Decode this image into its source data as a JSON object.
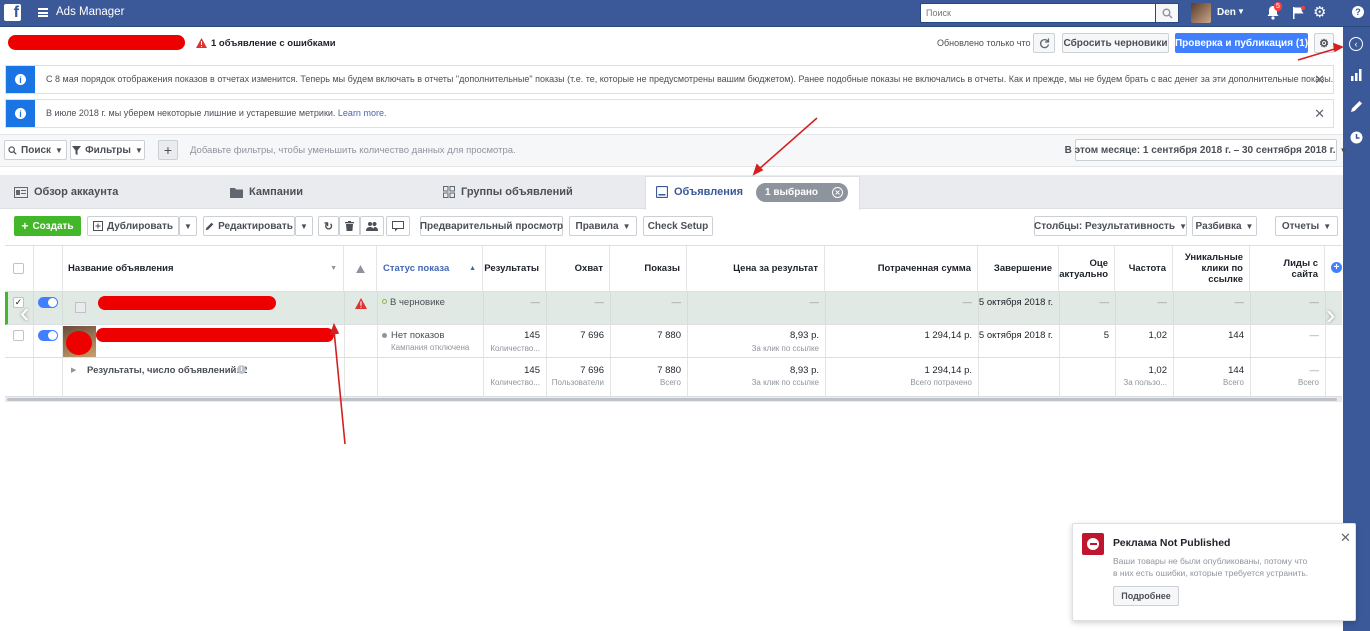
{
  "topbar": {
    "logo": "f",
    "app_title": "Ads Manager",
    "search_placeholder": "Поиск",
    "user_name": "Den",
    "notification_count": "5"
  },
  "subheader": {
    "error_text": "1 объявление с ошибками",
    "updated_text": "Обновлено только что",
    "reset_label": "Сбросить черновики",
    "publish_label": "Проверка и публикация (1)"
  },
  "banners": [
    {
      "text": "С 8 мая порядок отображения показов в отчетах изменится. Теперь мы будем включать в отчеты \"дополнительные\" показы (т.е. те, которые не предусмотрены вашим бюджетом). Ранее подобные показы не включались в отчеты. Как и прежде, мы не будем брать с вас денег за эти дополнительные показы."
    },
    {
      "text": "В июле 2018 г. мы уберем некоторые лишние и устаревшие метрики.",
      "link": "Learn more."
    }
  ],
  "filterbar": {
    "search_label": "Поиск",
    "filters_label": "Фильтры",
    "add_hint": "Добавьте фильтры, чтобы уменьшить количество данных для просмотра.",
    "date_range": "В этом месяце: 1 сентября 2018 г. – 30 сентября 2018 г."
  },
  "tabs": [
    {
      "label": "Обзор аккаунта"
    },
    {
      "label": "Кампании"
    },
    {
      "label": "Группы объявлений"
    },
    {
      "label": "Объявления"
    }
  ],
  "selected_badge": "1 выбрано",
  "toolbar": {
    "create": "Создать",
    "duplicate": "Дублировать",
    "edit": "Редактировать",
    "preview": "Предварительный просмотр",
    "rules": "Правила",
    "check_setup": "Check Setup",
    "columns": "Столбцы: Результативность",
    "breakdown": "Разбивка",
    "reports": "Отчеты"
  },
  "columns": {
    "name": "Название объявления",
    "status": "Статус показа",
    "results": "Результаты",
    "reach": "Охват",
    "impressions": "Показы",
    "cpr": "Цена за результат",
    "spent": "Потраченная сумма",
    "end": "Завершение",
    "relevance": "Оце актуально",
    "frequency": "Частота",
    "unique_clicks": "Уникальные клики по ссылке",
    "leads": "Лиды с сайта"
  },
  "rows": [
    {
      "status": "В черновике",
      "status_color": "#8ab94a",
      "results": "—",
      "reach": "—",
      "impressions": "—",
      "cpr": "—",
      "spent": "—",
      "end": "5 октября 2018 г.",
      "relevance": "—",
      "frequency": "—",
      "unique_clicks": "—",
      "leads": "—"
    },
    {
      "status": "Нет показов",
      "status_sub": "Кампания отключена",
      "status_color": "#90949c",
      "results": "145",
      "results_sub": "Количество...",
      "reach": "7 696",
      "impressions": "7 880",
      "cpr": "8,93 р.",
      "cpr_sub": "За клик по ссылке",
      "spent": "1 294,14 р.",
      "end": "5 октября 2018 г.",
      "relevance": "5",
      "frequency": "1,02",
      "unique_clicks": "144",
      "leads": "—"
    }
  ],
  "totals": {
    "label": "Результаты, число объявлений: 2",
    "results": "145",
    "results_sub": "Количество...",
    "reach": "7 696",
    "reach_sub": "Пользователи",
    "impressions": "7 880",
    "impressions_sub": "Всего",
    "cpr": "8,93 р.",
    "cpr_sub": "За клик по ссылке",
    "spent": "1 294,14 р.",
    "spent_sub": "Всего потрачено",
    "frequency": "1,02",
    "frequency_sub": "За пользо...",
    "unique_clicks": "144",
    "unique_clicks_sub": "Всего",
    "leads": "—",
    "leads_sub": "Всего"
  },
  "toast": {
    "title": "Реклама Not Published",
    "body": "Ваши товары не были опубликованы, потому что в них есть ошибки, которые требуется устранить.",
    "button": "Подробнее"
  }
}
